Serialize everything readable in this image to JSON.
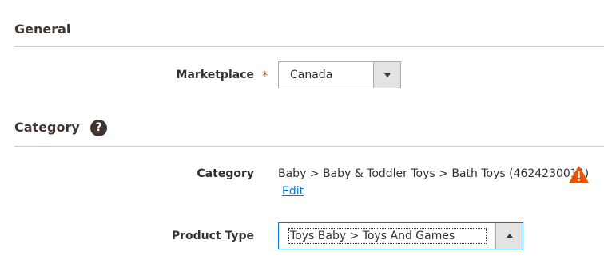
{
  "general": {
    "title": "General",
    "marketplace_label": "Marketplace",
    "required_mark": "*",
    "marketplace_value": "Canada"
  },
  "category_section": {
    "title": "Category",
    "help_glyph": "?",
    "category_label": "Category",
    "category_value": "Baby > Baby & Toddler Toys > Bath Toys (4624230011)",
    "edit_label": "Edit",
    "product_type_label": "Product Type",
    "product_type_value": "Toys Baby > Toys And Games"
  },
  "icons": {
    "help": "question-circle-icon",
    "warning": "warning-triangle-icon",
    "marketplace_dropdown": "chevron-down-icon",
    "product_type_dropdown": "chevron-up-icon"
  },
  "colors": {
    "required": "#eb5202",
    "warning": "#eb5202",
    "link": "#007bdb",
    "heading": "#41362f",
    "focus_border": "#007bdb"
  }
}
